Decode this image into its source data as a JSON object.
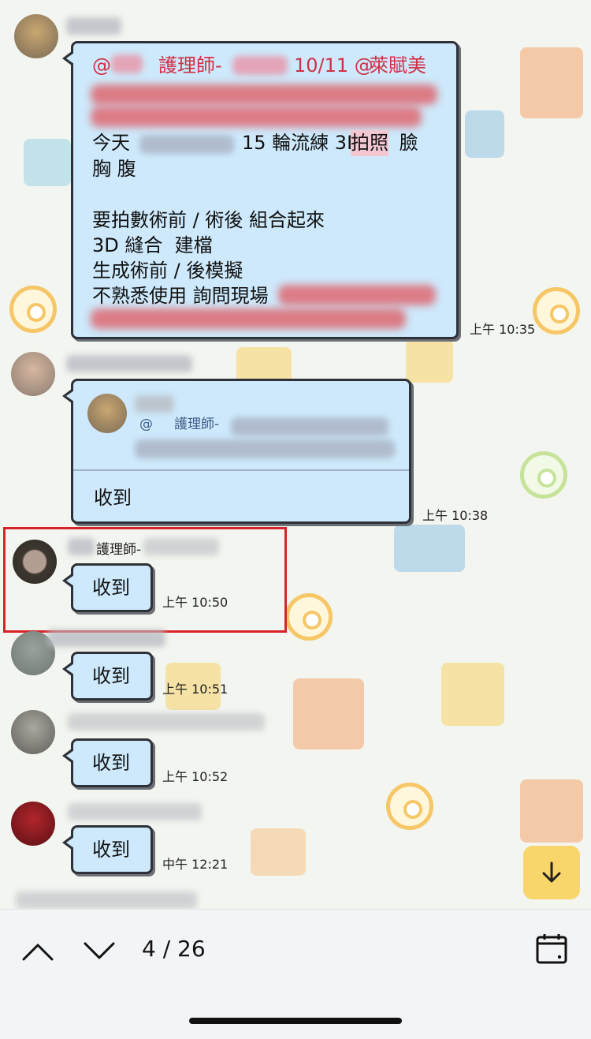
{
  "messages": [
    {
      "lines": [
        "@",
        "護理師-",
        "10/11 @",
        "萊賦美"
      ],
      "line1_mid": "護理師-",
      "line1_date": "10/11 @",
      "line1_end": "萊賦美",
      "l3_a": "今天",
      "l3_b": "15 輪流練 3D",
      "l3_hl": "拍照",
      "l3_c": " 臉",
      "l4": "胸 腹",
      "l5": "要拍數術前 / 術後 組合起來",
      "l6": "3D 縫合  建檔",
      "l7": "生成術前 / 後模擬",
      "l8": "不熟悉使用 詢問現場",
      "time": "上午 10:35"
    },
    {
      "quote_role": "@     護理師-",
      "text": "收到",
      "time": "上午 10:38"
    },
    {
      "sender": "護理師-",
      "text": "收到",
      "time": "上午 10:50"
    },
    {
      "text": "收到",
      "time": "上午 10:51"
    },
    {
      "text": "收到",
      "time": "上午 10:52"
    },
    {
      "text": "收到",
      "time": "中午 12:21"
    }
  ],
  "search_nav": {
    "counter": "4 / 26",
    "prev_icon": "chevron-up-icon",
    "next_icon": "chevron-down-icon",
    "calendar_icon": "calendar-icon",
    "scroll_icon": "arrow-down-icon"
  },
  "colors": {
    "bubble": "#cde9fb",
    "mention": "#d03046",
    "highlight_box": "#d8232a",
    "scroll_button": "#f9d66b"
  }
}
